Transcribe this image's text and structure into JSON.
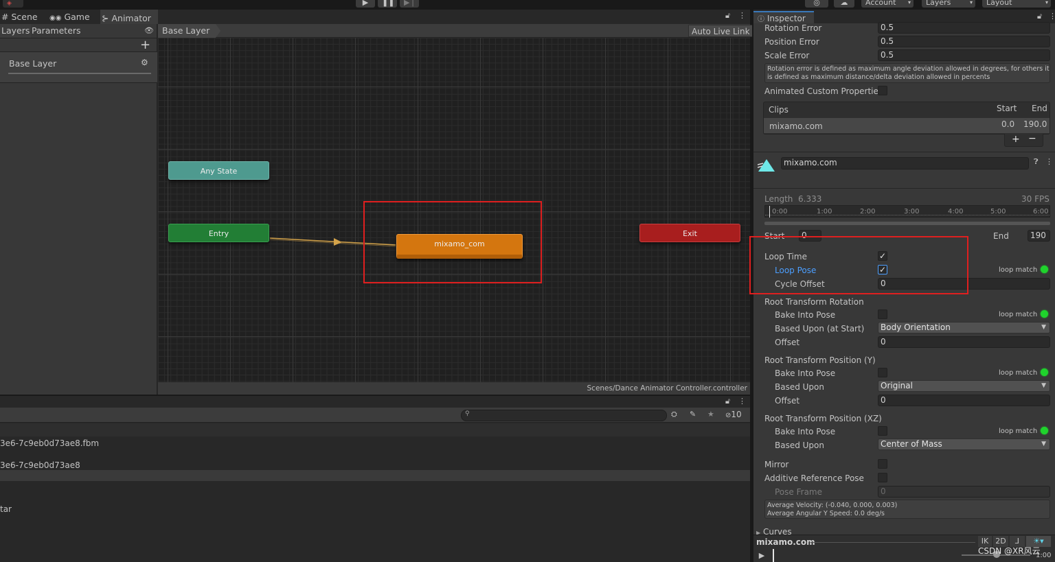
{
  "toolbar": {
    "account_label": "Account",
    "layers_label": "Layers",
    "layout_label": "Layout"
  },
  "tabs": {
    "scene": "Scene",
    "game": "Game",
    "animator": "Animator"
  },
  "animator": {
    "sub_tabs": {
      "layers": "Layers",
      "parameters": "Parameters"
    },
    "layer_name": "Base Layer",
    "breadcrumb": "Base Layer",
    "auto_live_link": "Auto Live Link",
    "path": "Scenes/Dance Animator Controller.controller",
    "nodes": {
      "any_state": "Any State",
      "entry": "Entry",
      "state": "mixamo_com",
      "exit": "Exit"
    }
  },
  "project": {
    "count": "10",
    "files": [
      "3e6-7c9eb0d73ae8.fbm",
      "3e6-7c9eb0d73ae8",
      "tar"
    ]
  },
  "inspector": {
    "tab_label": "Inspector",
    "rotation_error_label": "Rotation Error",
    "rotation_error": "0.5",
    "position_error_label": "Position Error",
    "position_error": "0.5",
    "scale_error_label": "Scale Error",
    "scale_error": "0.5",
    "help_line1": "Rotation error is defined as maximum angle deviation allowed in degrees, for others it",
    "help_line2": "is defined as maximum distance/delta deviation allowed in percents",
    "animated_custom_props": "Animated Custom Properties",
    "clips_header": "Clips",
    "start_header": "Start",
    "end_header": "End",
    "clip_name": "mixamo.com",
    "clip_start": "0.0",
    "clip_end": "190.0",
    "clip_title": "mixamo.com",
    "length_label": "Length",
    "length_value": "6.333",
    "fps": "30 FPS",
    "timeline_ticks": [
      "0:00",
      "1:00",
      "2:00",
      "3:00",
      "4:00",
      "5:00",
      "6:00"
    ],
    "start_label": "Start",
    "start_value": "0",
    "end_label": "End",
    "end_value": "190",
    "loop_time": "Loop Time",
    "loop_pose": "Loop Pose",
    "loop_match": "loop match",
    "cycle_offset": "Cycle Offset",
    "cycle_offset_value": "0",
    "rt_rotation": "Root Transform Rotation",
    "bake_into_pose": "Bake Into Pose",
    "based_upon_start": "Based Upon (at Start)",
    "body_orientation": "Body Orientation",
    "offset": "Offset",
    "offset_value": "0",
    "rt_position_y": "Root Transform Position (Y)",
    "based_upon": "Based Upon",
    "original": "Original",
    "rt_position_xz": "Root Transform Position (XZ)",
    "center_of_mass": "Center of Mass",
    "mirror": "Mirror",
    "additive_ref_pose": "Additive Reference Pose",
    "pose_frame": "Pose Frame",
    "pose_frame_value": "0",
    "avg_velocity": "Average Velocity: (-0.040, 0.000, 0.003)",
    "avg_angular": "Average Angular Y Speed: 0.0 deg/s",
    "curves": "Curves",
    "preview_name": "mixamo.com",
    "ik": "IK",
    "two_d": "2D",
    "watermark": "CSDN @XR风云",
    "preview_time": "1:00"
  },
  "colors": {
    "any_state": "#4e9a8f",
    "entry": "#227e35",
    "state": "#d4760f",
    "exit": "#a81e1e",
    "highlight": "#e01f1f",
    "loop_match": "#1fd32c",
    "link": "#4c9fff"
  }
}
